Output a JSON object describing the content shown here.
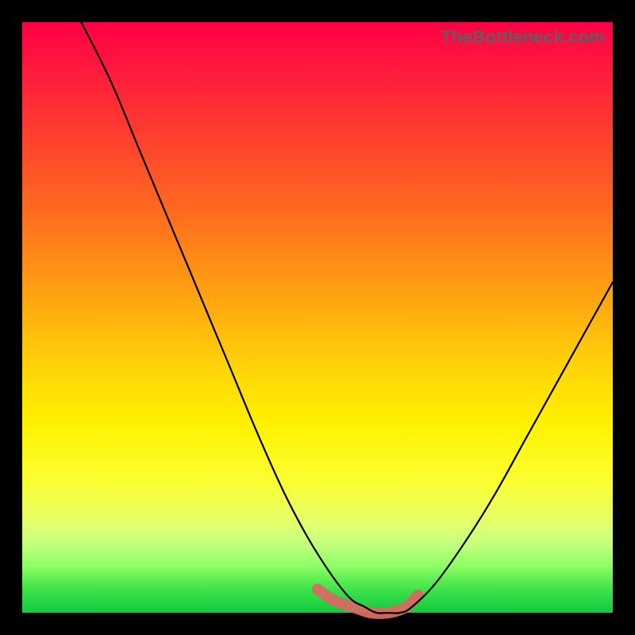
{
  "watermark": "TheBottleneck.com",
  "colors": {
    "frame": "#000000",
    "curve": "#000000",
    "highlight": "#d66a63",
    "gradient_top": "#ff0044",
    "gradient_bottom": "#11c93f"
  },
  "chart_data": {
    "type": "line",
    "title": "",
    "xlabel": "",
    "ylabel": "",
    "xlim": [
      0,
      100
    ],
    "ylim": [
      0,
      100
    ],
    "grid": false,
    "legend": false,
    "note": "Axes have no printed tick labels; values below are normalized 0–100 read off the plot area. Lower y = better (green). The curve is a V / bathtub shape with its minimum ≈ x 55–66. A thick salmon segment highlights the flat optimal region at the bottom.",
    "series": [
      {
        "name": "bottleneck-curve",
        "x": [
          10,
          15,
          20,
          25,
          30,
          35,
          40,
          45,
          50,
          55,
          58,
          60,
          62,
          64,
          66,
          70,
          75,
          80,
          85,
          90,
          95,
          100
        ],
        "y": [
          100,
          90,
          78,
          66,
          54,
          42,
          30,
          19,
          10,
          3,
          1,
          0,
          0,
          0,
          1,
          5,
          12,
          20,
          29,
          38,
          47,
          56
        ]
      },
      {
        "name": "optimal-highlight",
        "x": [
          50,
          53,
          56,
          59,
          62,
          65,
          67
        ],
        "y": [
          4,
          2,
          1,
          0,
          0,
          1,
          3
        ]
      }
    ]
  }
}
